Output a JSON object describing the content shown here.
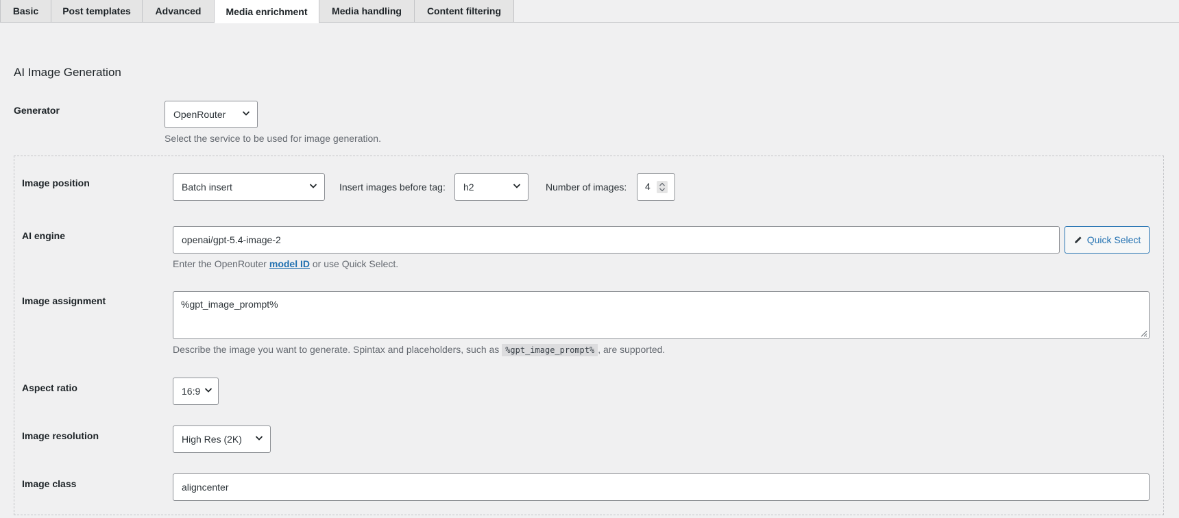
{
  "tabs": [
    {
      "label": "Basic"
    },
    {
      "label": "Post templates"
    },
    {
      "label": "Advanced"
    },
    {
      "label": "Media enrichment"
    },
    {
      "label": "Media handling"
    },
    {
      "label": "Content filtering"
    }
  ],
  "active_tab": "Media enrichment",
  "section": {
    "title": "AI Image Generation"
  },
  "generator": {
    "label": "Generator",
    "value": "OpenRouter",
    "description": "Select the service to be used for image generation."
  },
  "image_position": {
    "label": "Image position",
    "value": "Batch insert",
    "before_tag_label": "Insert images before tag:",
    "before_tag_value": "h2",
    "count_label": "Number of images:",
    "count_value": "4"
  },
  "ai_engine": {
    "label": "AI engine",
    "value": "openai/gpt-5.4-image-2",
    "quick_select_label": "Quick Select",
    "desc_prefix": "Enter the OpenRouter",
    "desc_link": "model ID",
    "desc_suffix": "or use Quick Select."
  },
  "image_assignment": {
    "label": "Image assignment",
    "value": "%gpt_image_prompt%",
    "desc_prefix": "Describe the image you want to generate. Spintax and placeholders, such as",
    "desc_code": "%gpt_image_prompt%",
    "desc_suffix": ", are supported."
  },
  "aspect_ratio": {
    "label": "Aspect ratio",
    "value": "16:9"
  },
  "image_resolution": {
    "label": "Image resolution",
    "value": "High Res (2K)"
  },
  "image_class": {
    "label": "Image class",
    "value": "aligncenter"
  },
  "colors": {
    "accent": "#2271b1",
    "background": "#f0f0f1",
    "border": "#8c8f94"
  }
}
